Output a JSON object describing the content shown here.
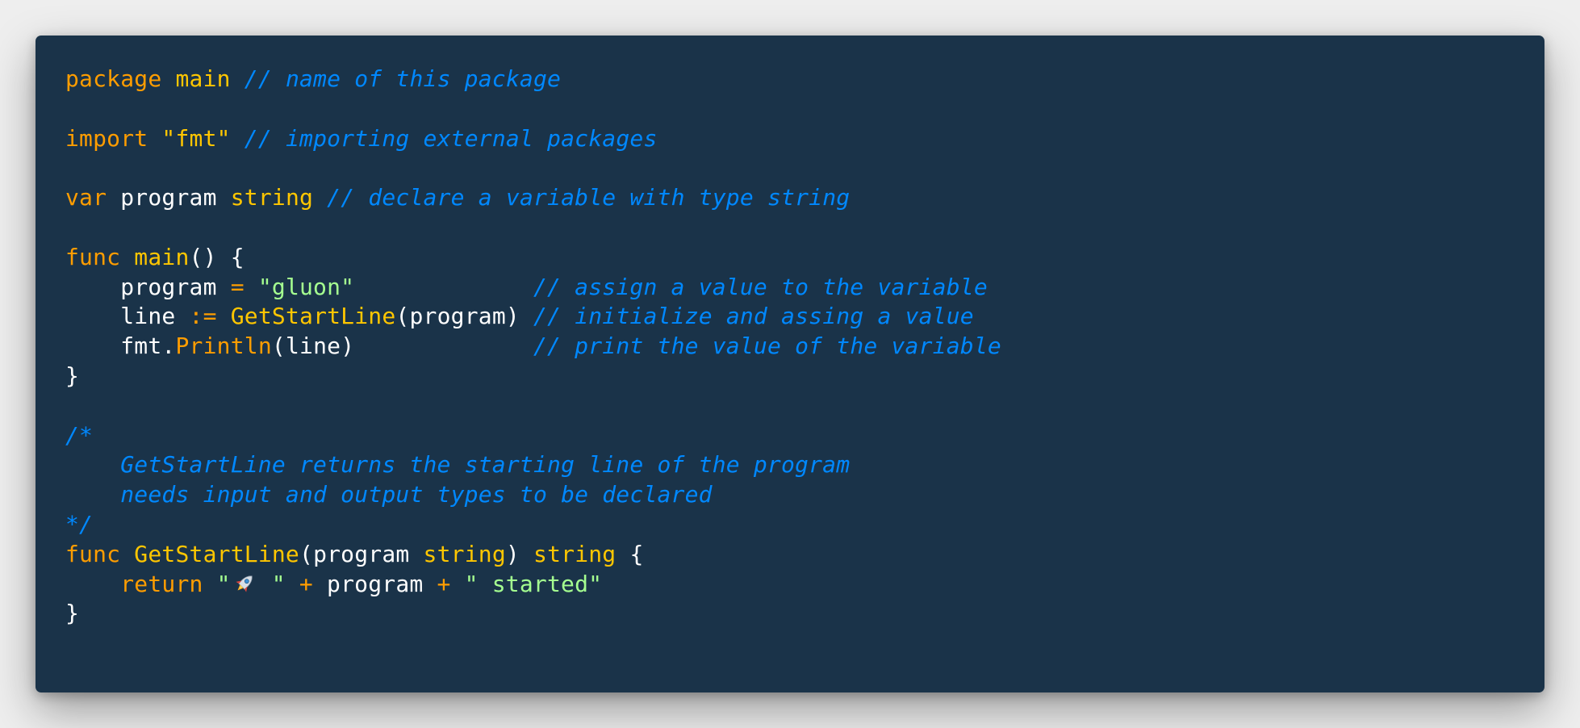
{
  "editor": {
    "background": "#1a3349",
    "theme_colors": {
      "keyword": "#ff9d00",
      "function": "#ffc600",
      "type": "#ffc600",
      "string": "#a5ff90",
      "comment": "#0088ff",
      "plain": "#ffffff"
    },
    "tokens": {
      "package": "package",
      "main_name": "main",
      "comment_package": "// name of this package",
      "import": "import",
      "fmt_str": "\"fmt\"",
      "comment_import": "// importing external packages",
      "var": "var",
      "program": "program",
      "string_type": "string",
      "comment_var": "// declare a variable with type string",
      "func": "func",
      "main_fn": "main",
      "main_parens": "() {",
      "assign": "=",
      "gluon_str": "\"gluon\"",
      "comment_assign": "// assign a value to the variable",
      "line": "line",
      "short_assign": ":=",
      "getstartline": "GetStartLine",
      "paren_open": "(",
      "paren_close": ")",
      "comment_init": "// initialize and assing a value",
      "fmt": "fmt",
      "dot": ".",
      "println": "Println",
      "comment_print": "// print the value of the variable",
      "brace_close": "}",
      "block_comment_open": "/*",
      "block_comment_line1": "GetStartLine returns the starting line of the program",
      "block_comment_line2": "needs input and output types to be declared",
      "block_comment_close": "*/",
      "brace_open": "{",
      "return": "return",
      "quote": "\"",
      "rocket_tail": " \"",
      "plus": "+",
      "started_str": "\" started\""
    }
  }
}
